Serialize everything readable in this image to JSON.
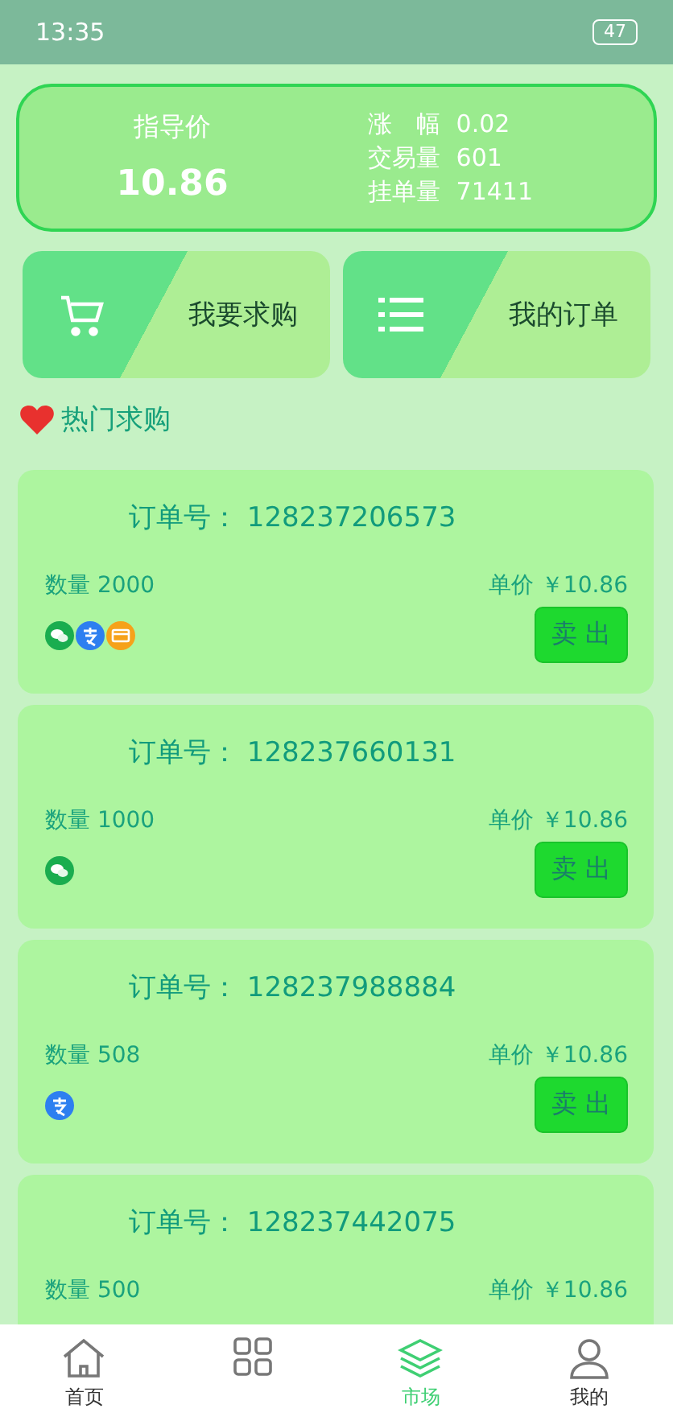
{
  "status_bar": {
    "time": "13:35",
    "battery": "47"
  },
  "summary": {
    "guide_label": "指导价",
    "guide_price": "10.86",
    "stats": [
      {
        "label": "涨　幅",
        "value": "0.02"
      },
      {
        "label": "交易量",
        "value": "601"
      },
      {
        "label": "挂单量",
        "value": "71411"
      }
    ]
  },
  "actions": [
    {
      "kind": "cart",
      "label": "我要求购"
    },
    {
      "kind": "list",
      "label": "我的订单"
    }
  ],
  "section_title": "热门求购",
  "orders": [
    {
      "order_label": "订单号：",
      "order_no": "128237206573",
      "quantity": "数量 2000",
      "price": "单价 ￥10.86",
      "payments": [
        {
          "kind": "wechat"
        },
        {
          "kind": "alipay"
        },
        {
          "kind": "card"
        }
      ],
      "button": "卖 出"
    },
    {
      "order_label": "订单号：",
      "order_no": "128237660131",
      "quantity": "数量 1000",
      "price": "单价 ￥10.86",
      "payments": [
        {
          "kind": "wechat"
        }
      ],
      "button": "卖 出"
    },
    {
      "order_label": "订单号：",
      "order_no": "128237988884",
      "quantity": "数量 508",
      "price": "单价 ￥10.86",
      "payments": [
        {
          "kind": "alipay"
        }
      ],
      "button": "卖 出"
    },
    {
      "order_label": "订单号：",
      "order_no": "128237442075",
      "quantity": "数量 500",
      "price": "单价 ￥10.86"
    }
  ],
  "nav": [
    {
      "kind": "home",
      "label": "首页",
      "selected": false
    },
    {
      "kind": "grid",
      "selected": false
    },
    {
      "kind": "layers",
      "label": "市场",
      "selected": true
    },
    {
      "kind": "user",
      "label": "我的",
      "selected": false
    }
  ]
}
